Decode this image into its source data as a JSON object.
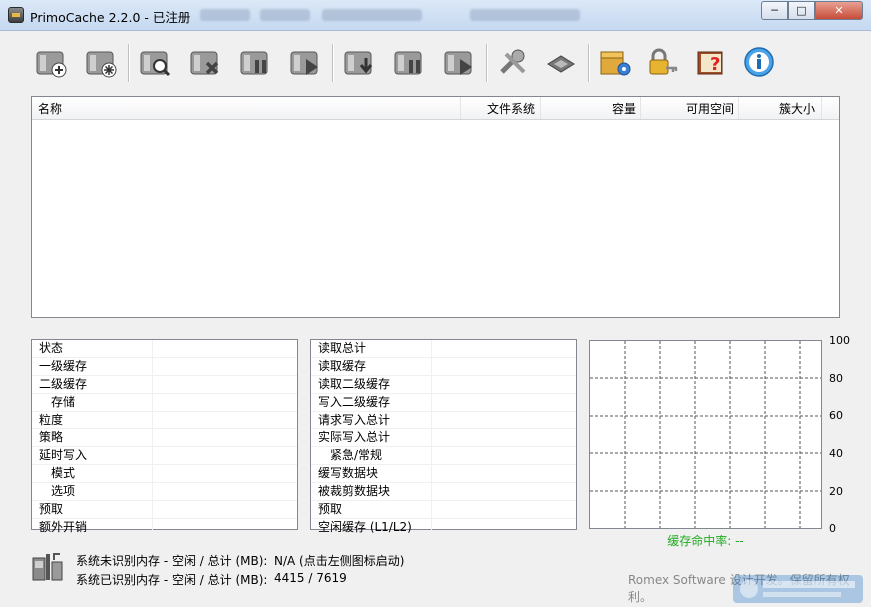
{
  "window": {
    "title": "PrimoCache 2.2.0 - 已注册"
  },
  "titlebar_buttons": {
    "minimize": "─",
    "maximize": "□",
    "close": "✕"
  },
  "toolbar": {
    "buttons": [
      {
        "name": "add-cache-task-icon"
      },
      {
        "name": "add-special-cache-icon"
      },
      {
        "name": "find-cache-icon"
      },
      {
        "name": "delete-cache-icon"
      },
      {
        "name": "pause-cache-icon"
      },
      {
        "name": "resume-cache-icon"
      },
      {
        "name": "flush-cache-icon"
      },
      {
        "name": "pause-level2-icon"
      },
      {
        "name": "resume-level2-icon"
      },
      {
        "name": "tools-icon"
      },
      {
        "name": "chip-icon"
      },
      {
        "name": "package-settings-icon"
      },
      {
        "name": "license-key-icon"
      },
      {
        "name": "help-book-icon"
      },
      {
        "name": "about-info-icon"
      }
    ]
  },
  "volume_list": {
    "columns": [
      "名称",
      "文件系统",
      "容量",
      "可用空间",
      "簇大小"
    ],
    "rows": []
  },
  "stats_left": [
    {
      "label": "状态",
      "indent": false
    },
    {
      "label": "一级缓存",
      "indent": false
    },
    {
      "label": "二级缓存",
      "indent": false
    },
    {
      "label": "存储",
      "indent": true
    },
    {
      "label": "粒度",
      "indent": false
    },
    {
      "label": "策略",
      "indent": false
    },
    {
      "label": "延时写入",
      "indent": false
    },
    {
      "label": "模式",
      "indent": true
    },
    {
      "label": "选项",
      "indent": true
    },
    {
      "label": "预取",
      "indent": false
    },
    {
      "label": "额外开销",
      "indent": false
    }
  ],
  "stats_right": [
    {
      "label": "读取总计",
      "indent": false
    },
    {
      "label": "读取缓存",
      "indent": false
    },
    {
      "label": "读取二级缓存",
      "indent": false
    },
    {
      "label": "写入二级缓存",
      "indent": false
    },
    {
      "label": "请求写入总计",
      "indent": false
    },
    {
      "label": "实际写入总计",
      "indent": false
    },
    {
      "label": "紧急/常规",
      "indent": true
    },
    {
      "label": "缓写数据块",
      "indent": false
    },
    {
      "label": "被裁剪数据块",
      "indent": false
    },
    {
      "label": "预取",
      "indent": false
    },
    {
      "label": "空闲缓存 (L1/L2)",
      "indent": false
    }
  ],
  "chart": {
    "y_ticks": [
      "100",
      "80",
      "60",
      "40",
      "20",
      "0"
    ],
    "hit_rate_label": "缓存命中率: --",
    "hit_rate_color": "#22aa22"
  },
  "memory": {
    "unrecognized_label": "系统未识别内存 - 空闲 / 总计 (MB):",
    "unrecognized_value": "N/A (点击左侧图标启动)",
    "recognized_label": "系统已识别内存 - 空闲 / 总计 (MB):",
    "recognized_value": "4415 / 7619"
  },
  "credit": "Romex Software 设计开发。保留所有权利。"
}
